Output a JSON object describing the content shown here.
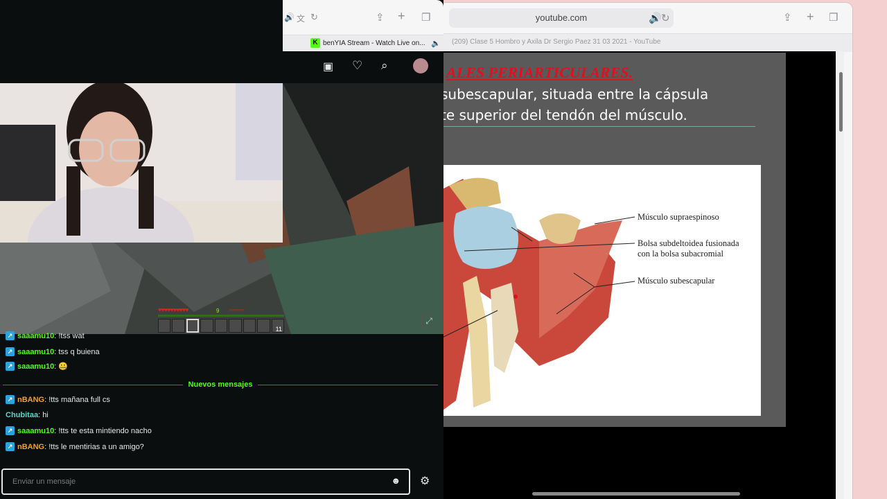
{
  "youtube_window": {
    "url": "youtube.com",
    "tab_title": "(209) Clase 5 Hombro y Axila Dr Sergio Paez 31 03 2021 - YouTube",
    "slide": {
      "heading": "ALES PERIARTICULARES.",
      "line1": "subescapular, situada entre la cápsula",
      "line2": "te superior del tendón del músculo.",
      "labels": {
        "supraespinoso": "Músculo supraespinoso",
        "bolsa_line1": "Bolsa subdeltoidea fusionada",
        "bolsa_line2": "con la bolsa subacromial",
        "subescapular": "Músculo subescapular"
      }
    }
  },
  "kick_window": {
    "tab_title": "benYIA Stream - Watch Live on...",
    "favicon_letter": "K",
    "game_hud": {
      "xp_level": "9",
      "slot_count": "11"
    },
    "chat": {
      "messages_before": [
        {
          "user": "saaamu10",
          "text": "!tss wat"
        },
        {
          "user": "saaamu10",
          "text": "tss q buiena"
        },
        {
          "user": "saaamu10",
          "text": "🤐"
        }
      ],
      "new_messages_label": "Nuevos mensajes",
      "messages_after": [
        {
          "user": "nBANG",
          "text": "!tts mañana full cs"
        },
        {
          "user": "Chubitaa",
          "text": "hi"
        },
        {
          "user": "saaamu10",
          "text": "!tts te esta mintiendo nacho"
        },
        {
          "user": "nBANG",
          "text": "!tts le mentirias a un amigo?"
        }
      ],
      "input_placeholder": "Enviar un mensaje"
    }
  },
  "colors": {
    "kick_green": "#53fc18",
    "slide_red": "#e0101e",
    "desktop_pink": "#f4d0d0"
  }
}
